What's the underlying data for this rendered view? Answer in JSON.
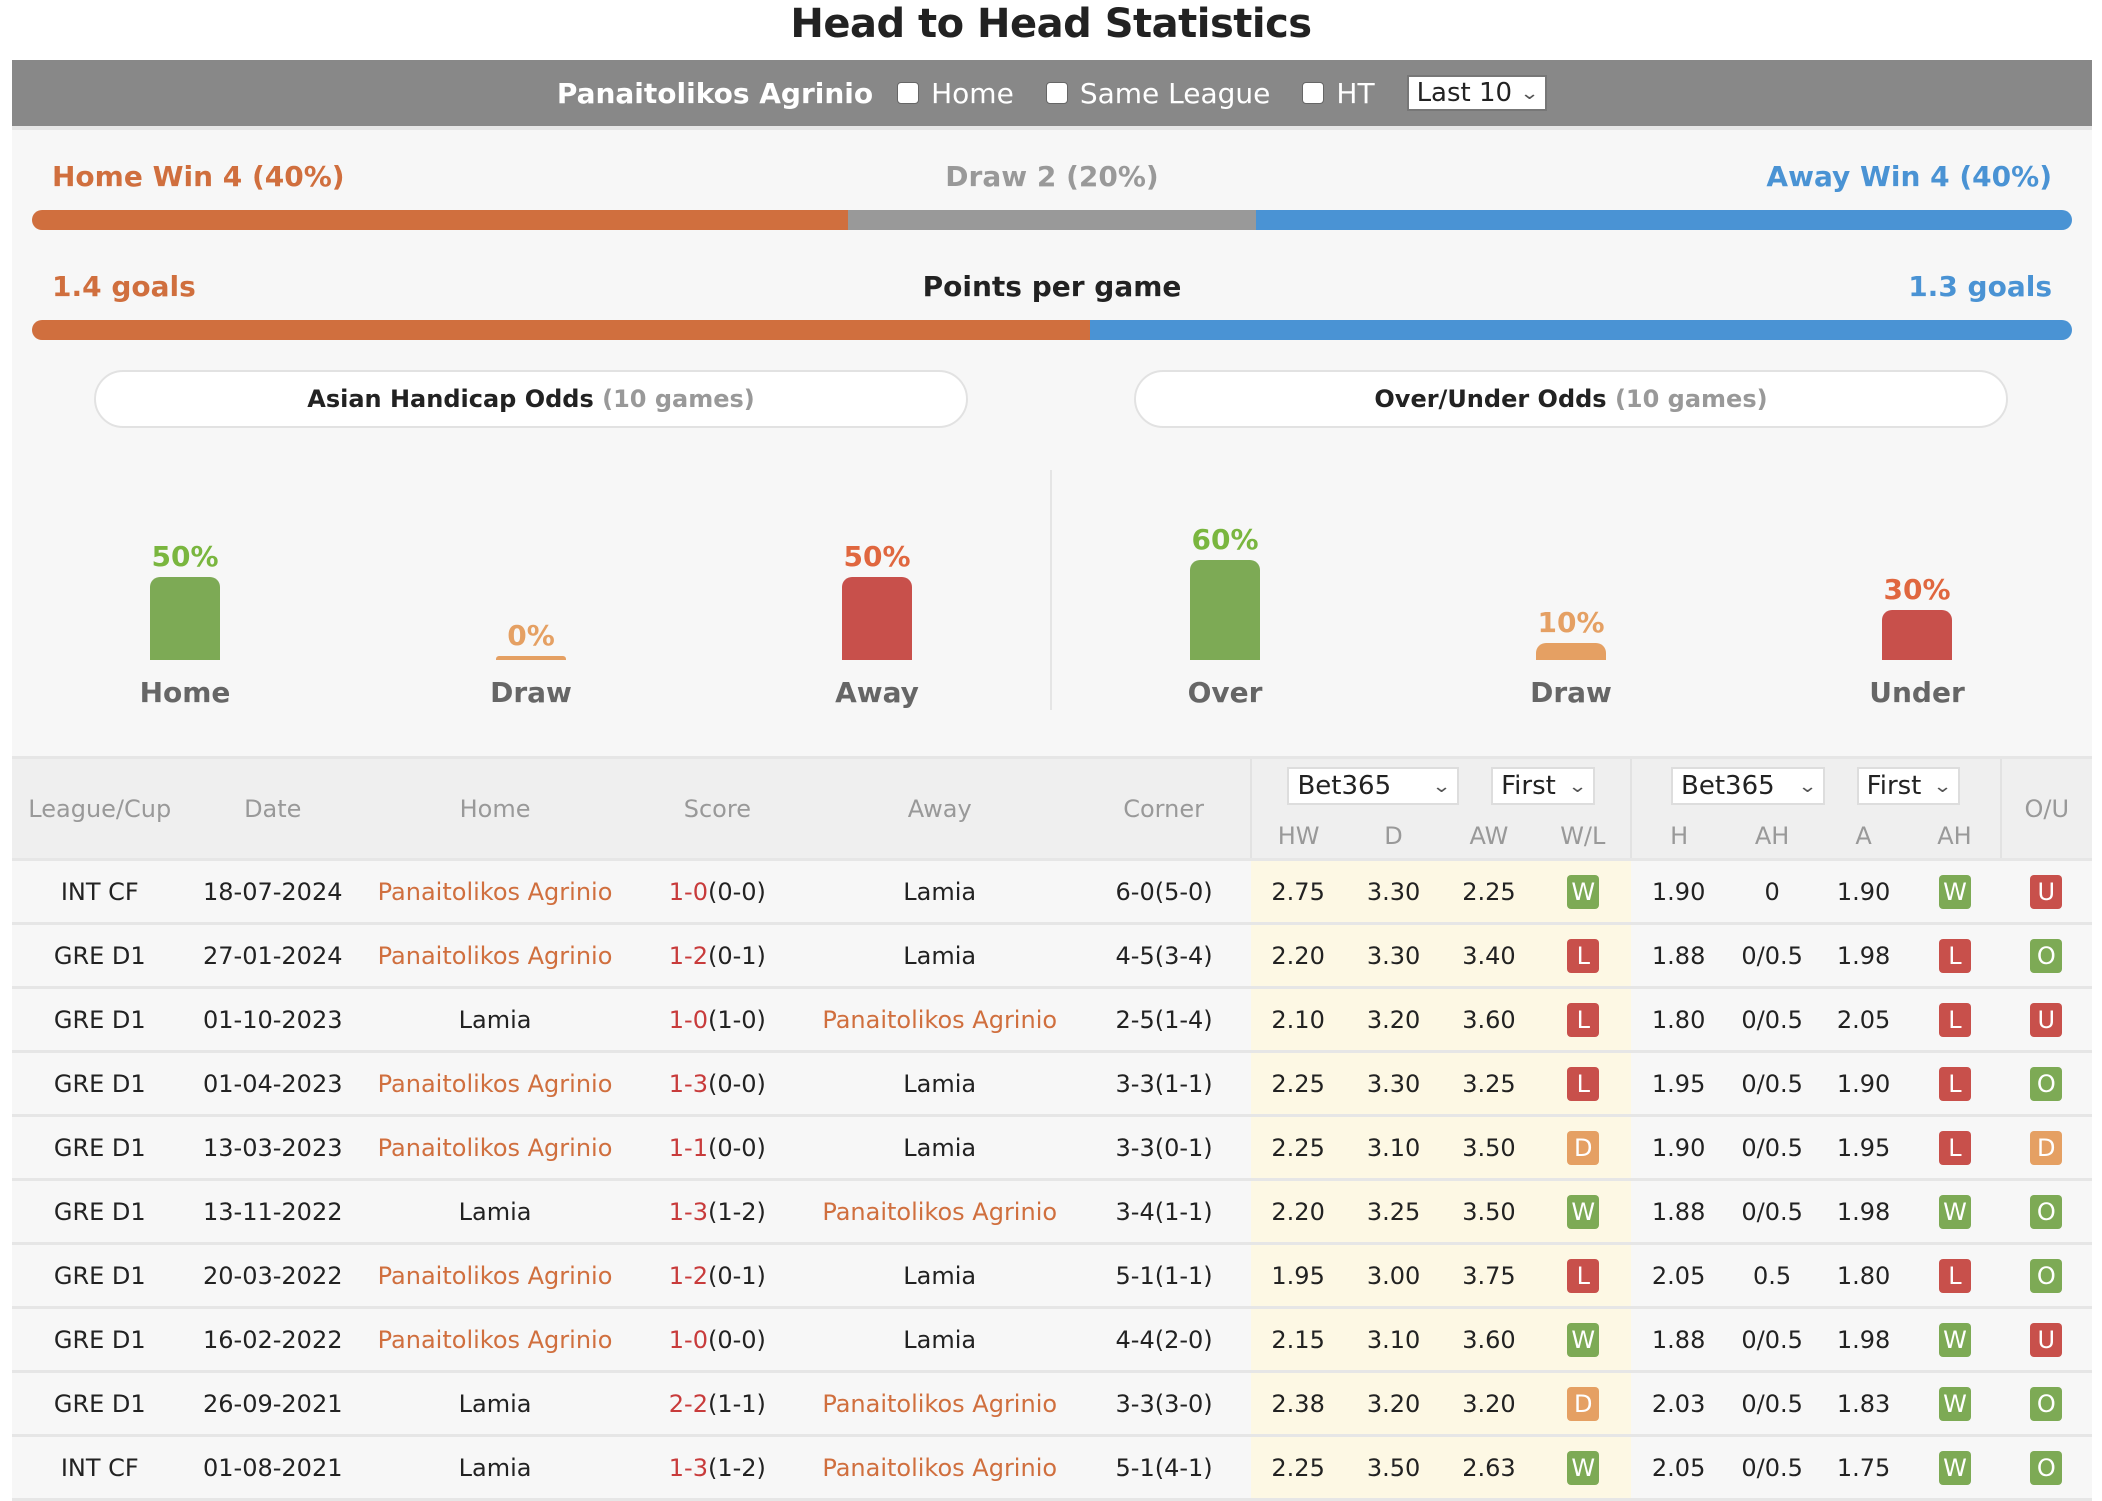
{
  "page": {
    "title": "Head to Head Statistics"
  },
  "filters": {
    "team": "Panaitolikos Agrinio",
    "checkboxes": [
      {
        "label": "Home",
        "checked": false
      },
      {
        "label": "Same League",
        "checked": false
      },
      {
        "label": "HT",
        "checked": false
      }
    ],
    "range_select": "Last 10"
  },
  "results_summary": {
    "home_label": "Home Win 4 (40%)",
    "draw_label": "Draw 2 (20%)",
    "away_label": "Away Win 4 (40%)",
    "home_pct": 40,
    "draw_pct": 20,
    "away_pct": 40
  },
  "goals_summary": {
    "home_label": "1.4 goals",
    "center_label": "Points per game",
    "away_label": "1.3 goals",
    "home_goals": 1.4,
    "away_goals": 1.3
  },
  "odds_tabs": {
    "asian": {
      "label": "Asian Handicap Odds",
      "games": "(10 games)"
    },
    "overunder": {
      "label": "Over/Under Odds",
      "games": "(10 games)"
    }
  },
  "asian_handicap": [
    {
      "label": "Home",
      "value": 50,
      "text": "50%",
      "color": "#7daa55",
      "text_color": "#7ab63f"
    },
    {
      "label": "Draw",
      "value": 0,
      "text": "0%",
      "color": "#e5a063",
      "text_color": "#e5a063"
    },
    {
      "label": "Away",
      "value": 50,
      "text": "50%",
      "color": "#c8504b",
      "text_color": "#e0673f"
    }
  ],
  "over_under": [
    {
      "label": "Over",
      "value": 60,
      "text": "60%",
      "color": "#7daa55",
      "text_color": "#7ab63f"
    },
    {
      "label": "Draw",
      "value": 10,
      "text": "10%",
      "color": "#e5a063",
      "text_color": "#e5a063"
    },
    {
      "label": "Under",
      "value": 30,
      "text": "30%",
      "color": "#c8504b",
      "text_color": "#e0673f"
    }
  ],
  "colors": {
    "home": "#d06f3e",
    "draw": "#999999",
    "away": "#4a93d4"
  },
  "table": {
    "headers": {
      "league": "League/Cup",
      "date": "Date",
      "home": "Home",
      "score": "Score",
      "away": "Away",
      "corner": "Corner",
      "odds1_bookmaker": "Bet365",
      "odds1_type": "First",
      "odds2_bookmaker": "Bet365",
      "odds2_type": "First",
      "hw": "HW",
      "d": "D",
      "aw": "AW",
      "wl": "W/L",
      "h": "H",
      "ah": "AH",
      "a": "A",
      "ah2": "AH",
      "ou": "O/U"
    },
    "rows": [
      {
        "league": "INT CF",
        "date": "18-07-2024",
        "home": "Panaitolikos Agrinio",
        "away": "Lamia",
        "home_hl": true,
        "score_ft": "1-0",
        "score_ht": "(0-0)",
        "corner": "6-0(5-0)",
        "hw": "2.75",
        "d": "3.30",
        "aw": "2.25",
        "wl": "W",
        "h": "1.90",
        "ah": "0",
        "a": "1.90",
        "ah_res": "W",
        "ou": "U"
      },
      {
        "league": "GRE D1",
        "date": "27-01-2024",
        "home": "Panaitolikos Agrinio",
        "away": "Lamia",
        "home_hl": true,
        "score_ft": "1-2",
        "score_ht": "(0-1)",
        "corner": "4-5(3-4)",
        "hw": "2.20",
        "d": "3.30",
        "aw": "3.40",
        "wl": "L",
        "h": "1.88",
        "ah": "0/0.5",
        "a": "1.98",
        "ah_res": "L",
        "ou": "O"
      },
      {
        "league": "GRE D1",
        "date": "01-10-2023",
        "home": "Lamia",
        "away": "Panaitolikos Agrinio",
        "home_hl": false,
        "score_ft": "1-0",
        "score_ht": "(1-0)",
        "corner": "2-5(1-4)",
        "hw": "2.10",
        "d": "3.20",
        "aw": "3.60",
        "wl": "L",
        "h": "1.80",
        "ah": "0/0.5",
        "a": "2.05",
        "ah_res": "L",
        "ou": "U"
      },
      {
        "league": "GRE D1",
        "date": "01-04-2023",
        "home": "Panaitolikos Agrinio",
        "away": "Lamia",
        "home_hl": true,
        "score_ft": "1-3",
        "score_ht": "(0-0)",
        "corner": "3-3(1-1)",
        "hw": "2.25",
        "d": "3.30",
        "aw": "3.25",
        "wl": "L",
        "h": "1.95",
        "ah": "0/0.5",
        "a": "1.90",
        "ah_res": "L",
        "ou": "O"
      },
      {
        "league": "GRE D1",
        "date": "13-03-2023",
        "home": "Panaitolikos Agrinio",
        "away": "Lamia",
        "home_hl": true,
        "score_ft": "1-1",
        "score_ht": "(0-0)",
        "corner": "3-3(0-1)",
        "hw": "2.25",
        "d": "3.10",
        "aw": "3.50",
        "wl": "D",
        "h": "1.90",
        "ah": "0/0.5",
        "a": "1.95",
        "ah_res": "L",
        "ou": "D"
      },
      {
        "league": "GRE D1",
        "date": "13-11-2022",
        "home": "Lamia",
        "away": "Panaitolikos Agrinio",
        "home_hl": false,
        "score_ft": "1-3",
        "score_ht": "(1-2)",
        "corner": "3-4(1-1)",
        "hw": "2.20",
        "d": "3.25",
        "aw": "3.50",
        "wl": "W",
        "h": "1.88",
        "ah": "0/0.5",
        "a": "1.98",
        "ah_res": "W",
        "ou": "O"
      },
      {
        "league": "GRE D1",
        "date": "20-03-2022",
        "home": "Panaitolikos Agrinio",
        "away": "Lamia",
        "home_hl": true,
        "score_ft": "1-2",
        "score_ht": "(0-1)",
        "corner": "5-1(1-1)",
        "hw": "1.95",
        "d": "3.00",
        "aw": "3.75",
        "wl": "L",
        "h": "2.05",
        "ah": "0.5",
        "a": "1.80",
        "ah_res": "L",
        "ou": "O"
      },
      {
        "league": "GRE D1",
        "date": "16-02-2022",
        "home": "Panaitolikos Agrinio",
        "away": "Lamia",
        "home_hl": true,
        "score_ft": "1-0",
        "score_ht": "(0-0)",
        "corner": "4-4(2-0)",
        "hw": "2.15",
        "d": "3.10",
        "aw": "3.60",
        "wl": "W",
        "h": "1.88",
        "ah": "0/0.5",
        "a": "1.98",
        "ah_res": "W",
        "ou": "U"
      },
      {
        "league": "GRE D1",
        "date": "26-09-2021",
        "home": "Lamia",
        "away": "Panaitolikos Agrinio",
        "home_hl": false,
        "score_ft": "2-2",
        "score_ht": "(1-1)",
        "corner": "3-3(3-0)",
        "hw": "2.38",
        "d": "3.20",
        "aw": "3.20",
        "wl": "D",
        "h": "2.03",
        "ah": "0/0.5",
        "a": "1.83",
        "ah_res": "W",
        "ou": "O"
      },
      {
        "league": "INT CF",
        "date": "01-08-2021",
        "home": "Lamia",
        "away": "Panaitolikos Agrinio",
        "home_hl": false,
        "score_ft": "1-3",
        "score_ht": "(1-2)",
        "corner": "5-1(4-1)",
        "hw": "2.25",
        "d": "3.50",
        "aw": "2.63",
        "wl": "W",
        "h": "2.05",
        "ah": "0/0.5",
        "a": "1.75",
        "ah_res": "W",
        "ou": "O"
      }
    ]
  }
}
